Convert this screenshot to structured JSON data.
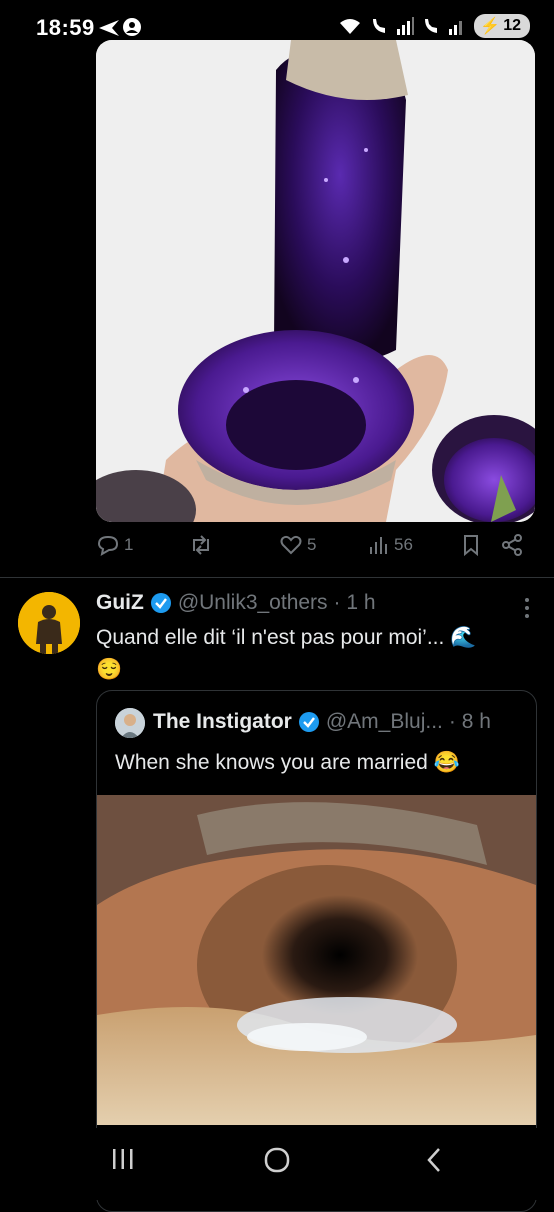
{
  "status_bar": {
    "time": "18:59",
    "battery": "12"
  },
  "tweet1": {
    "actions": {
      "replies": "1",
      "reposts": "",
      "likes": "5",
      "views": "56"
    }
  },
  "tweet2": {
    "name": "GuiZ",
    "handle": "@Unlik3_others",
    "time": "· 1 h",
    "text": "Quand elle dit ‘il n'est pas pour moi’... 🌊",
    "text2": "😌"
  },
  "quote": {
    "name": "The Instigator",
    "handle": "@Am_Bluj...",
    "time": "· 8 h",
    "text": "When she knows you are married 😂"
  },
  "colors": {
    "accent": "#1d9bf0",
    "secondary_text": "#71767b",
    "border": "#2f3336"
  }
}
